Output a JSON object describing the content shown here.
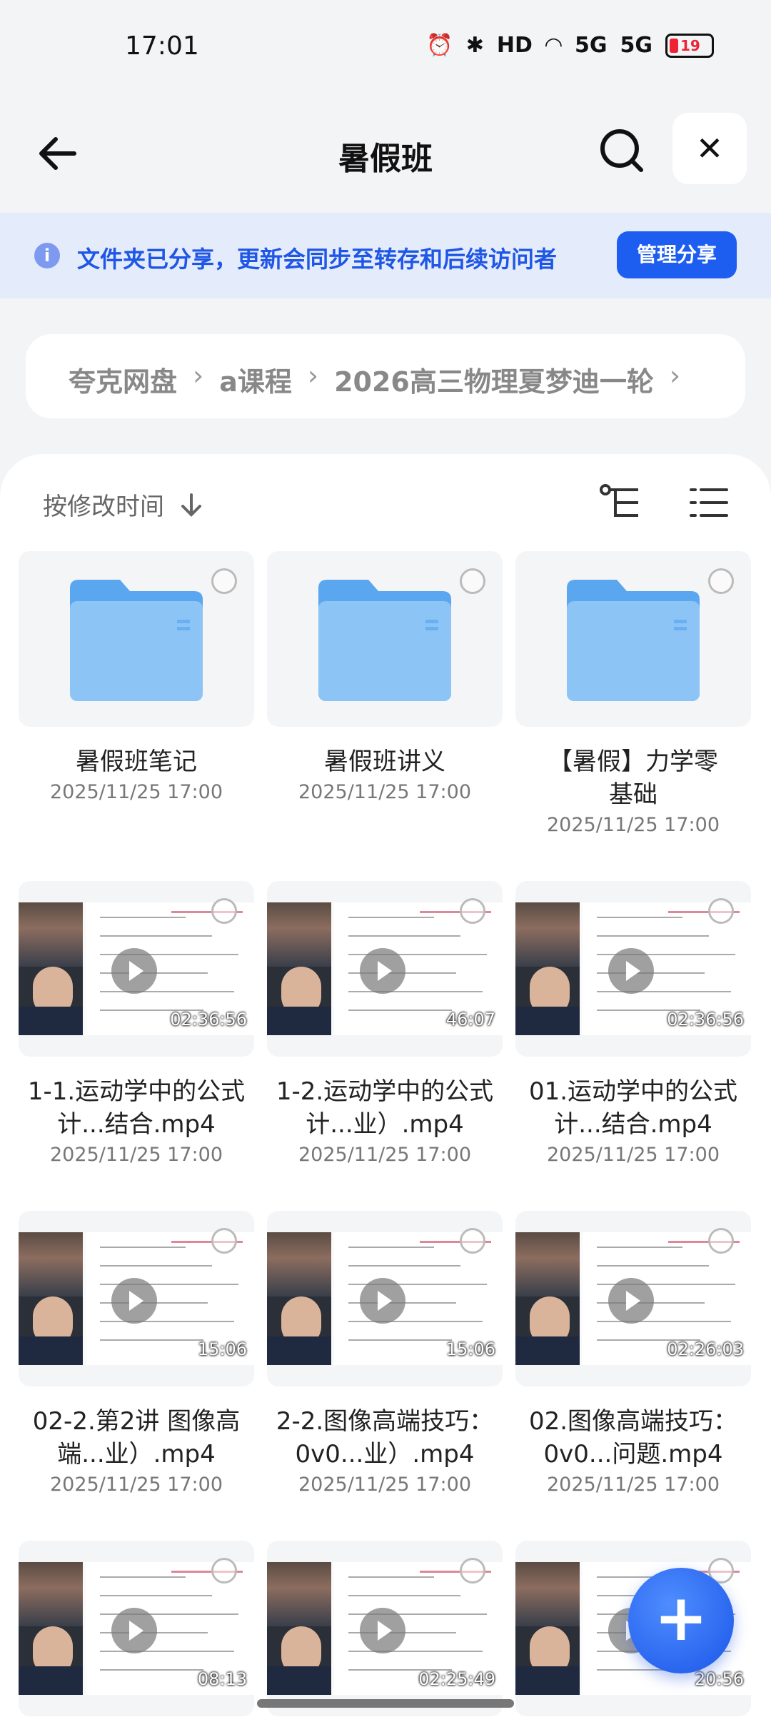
{
  "status_bar": {
    "time": "17:01",
    "battery": "19",
    "signal1": "5G",
    "signal2": "5G",
    "hd": "HD"
  },
  "header": {
    "title": "暑假班"
  },
  "banner": {
    "text": "文件夹已分享，更新会同步至转存和后续访问者",
    "button": "管理分享"
  },
  "breadcrumb": {
    "items": [
      "夸克网盘",
      "a课程",
      "2026高三物理夏梦迪一轮"
    ]
  },
  "sort": {
    "label": "按修改时间"
  },
  "files": [
    {
      "name": "暑假班笔记",
      "date": "2025/11/25 17:00",
      "type": "folder"
    },
    {
      "name": "暑假班讲义",
      "date": "2025/11/25 17:00",
      "type": "folder"
    },
    {
      "name": "【暑假】力学零基础",
      "date": "2025/11/25 17:00",
      "type": "folder"
    },
    {
      "name": "1-1.运动学中的公式计...结合.mp4",
      "date": "2025/11/25 17:00",
      "type": "video",
      "duration": "02:36:56"
    },
    {
      "name": "1-2.运动学中的公式计...业）.mp4",
      "date": "2025/11/25 17:00",
      "type": "video",
      "duration": "46:07"
    },
    {
      "name": "01.运动学中的公式计...结合.mp4",
      "date": "2025/11/25 17:00",
      "type": "video",
      "duration": "02:36:56"
    },
    {
      "name": "02-2.第2讲 图像高端...业）.mp4",
      "date": "2025/11/25 17:00",
      "type": "video",
      "duration": "15:06"
    },
    {
      "name": "2-2.图像高端技巧：0v0...业）.mp4",
      "date": "2025/11/25 17:00",
      "type": "video",
      "duration": "15:06"
    },
    {
      "name": "02.图像高端技巧：0v0...问题.mp4",
      "date": "2025/11/25 17:00",
      "type": "video",
      "duration": "02:26:03"
    },
    {
      "type": "video",
      "duration": "08:13"
    },
    {
      "type": "video",
      "duration": "02:25:49"
    },
    {
      "type": "video",
      "duration": "20:56"
    }
  ],
  "colors": {
    "accent": "#1d5ef1",
    "banner_bg": "#e4ebfb",
    "folder": "#5aa7ef"
  }
}
